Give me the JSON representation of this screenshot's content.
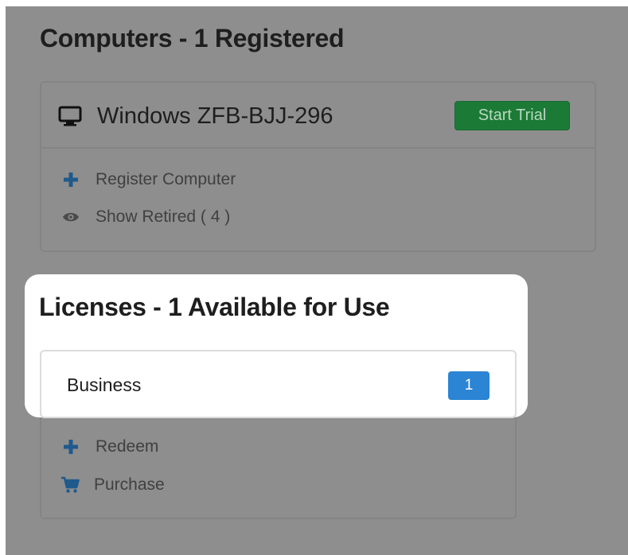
{
  "computers": {
    "title": "Computers - 1 Registered",
    "computer_name": "Windows ZFB-BJJ-296",
    "trial_button": "Start Trial",
    "actions": {
      "register": "Register Computer",
      "show_retired": "Show Retired ( 4 )"
    }
  },
  "licenses": {
    "title": "Licenses - 1 Available for Use",
    "license_name": "Business",
    "license_count": "1",
    "actions": {
      "redeem": "Redeem",
      "purchase": "Purchase"
    }
  },
  "icons": {
    "computer": "monitor-icon",
    "register": "plus-icon",
    "retired": "eye-icon",
    "redeem": "plus-icon",
    "purchase": "cart-icon"
  },
  "colors": {
    "overlay": "#8e8e8e",
    "accent_blue": "#2b84d4",
    "icon_blue": "#1f5a8c",
    "trial_green": "#1c7a37",
    "text_dark": "#1e1e1e"
  }
}
